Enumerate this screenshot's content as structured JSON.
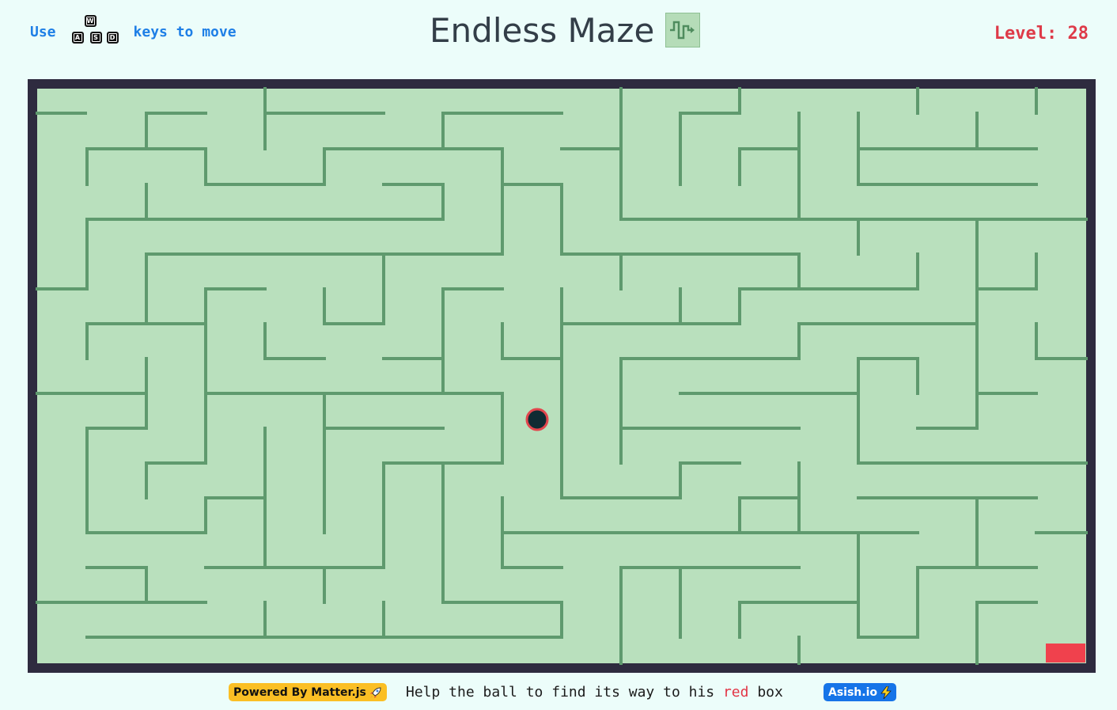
{
  "header": {
    "instruction_prefix": "Use",
    "instruction_suffix": "keys to move",
    "keys": [
      "W",
      "A",
      "S",
      "D"
    ],
    "title": "Endless Maze",
    "title_icon": "maze-path-icon",
    "level_text": "Level: 28"
  },
  "footer": {
    "powered_by": "Powered By Matter.js",
    "powered_by_icon": "rocket-icon",
    "help_part1": "Help the ball to find its way to his ",
    "help_red_word": "red",
    "help_part2": " box",
    "author_badge": "Asish.io",
    "author_icon": "lightning-icon"
  },
  "colors": {
    "page_bg": "#ecfdfa",
    "maze_border": "#2e2b3f",
    "maze_floor": "#b9e0bd",
    "maze_wall": "#5f9a6e",
    "ball_fill": "#0f2b33",
    "ball_outline": "#e2464d",
    "goal": "#f0414d",
    "level": "#de3a48",
    "instruction": "#1e7fe6"
  }
}
